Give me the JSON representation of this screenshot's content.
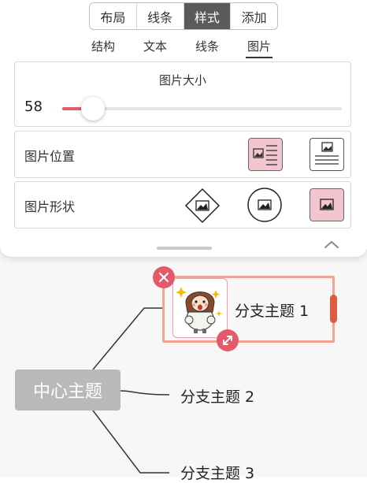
{
  "top_tabs": {
    "items": [
      "布局",
      "线条",
      "样式",
      "添加"
    ],
    "active_index": 2
  },
  "sub_tabs": {
    "items": [
      "结构",
      "文本",
      "线条",
      "图片"
    ],
    "active_index": 3
  },
  "image_size": {
    "title": "图片大小",
    "value": "58",
    "slider_fraction": 0.11
  },
  "image_position": {
    "label": "图片位置",
    "options": [
      "image-left-of-text-icon",
      "image-above-text-icon"
    ],
    "selected_index": 0
  },
  "image_shape": {
    "label": "图片形状",
    "options": [
      "diamond-shape-icon",
      "circle-shape-icon",
      "square-shape-icon"
    ],
    "selected_index": 2
  },
  "colors": {
    "accent": "#e35a6b",
    "selected_fill": "#f3c6cf",
    "selection_border": "#f0a592",
    "handle": "#e05a3e",
    "central_node": "#b9b9b9"
  },
  "mindmap": {
    "central": "中心主题",
    "branches": [
      "分支主题 1",
      "分支主题 2",
      "分支主题 3"
    ]
  }
}
